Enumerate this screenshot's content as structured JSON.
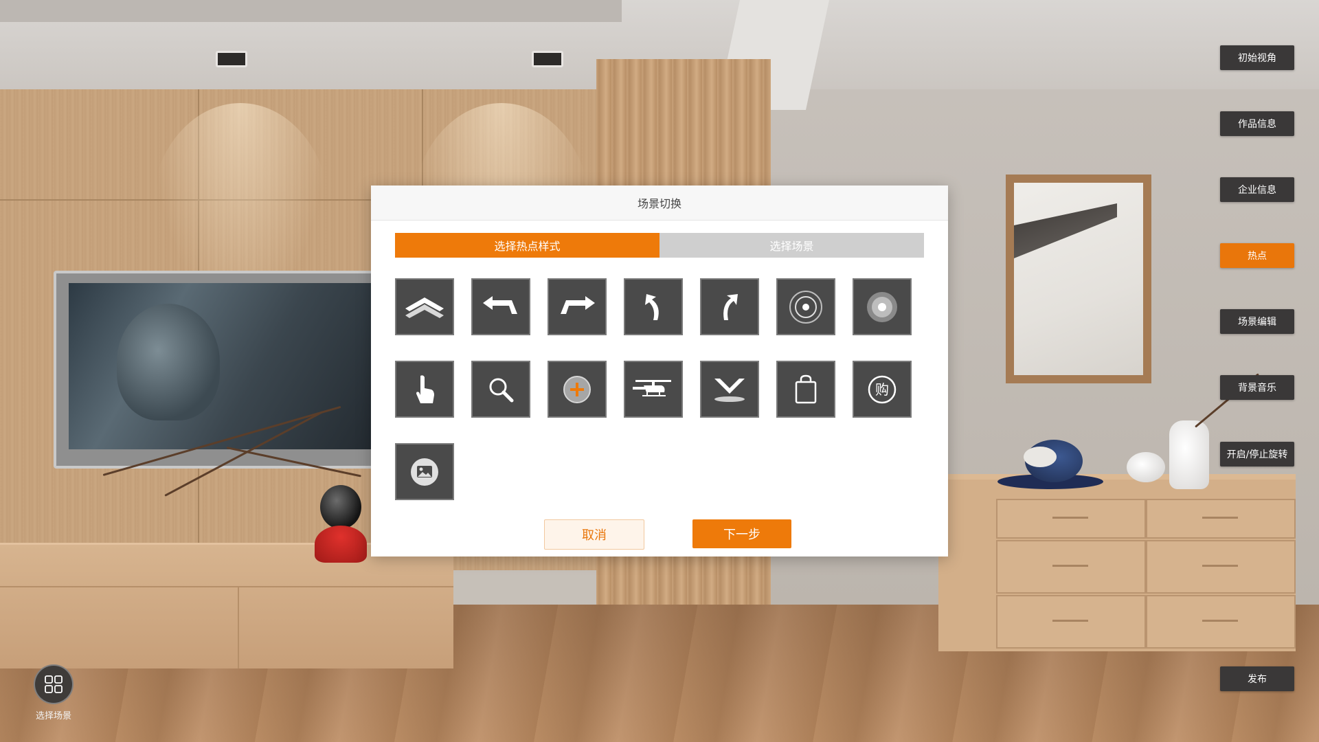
{
  "side_menu": {
    "items": [
      {
        "label": "初始视角",
        "active": false
      },
      {
        "label": "作品信息",
        "active": false
      },
      {
        "label": "企业信息",
        "active": false
      },
      {
        "label": "热点",
        "active": true
      },
      {
        "label": "场景编辑",
        "active": false
      },
      {
        "label": "背景音乐",
        "active": false
      },
      {
        "label": "开启/停止旋转",
        "active": false
      }
    ],
    "publish_label": "发布"
  },
  "scene_selector": {
    "label": "选择场景",
    "icon": "grid-icon"
  },
  "dialog": {
    "title": "场景切换",
    "tabs": [
      {
        "label": "选择热点样式",
        "active": true
      },
      {
        "label": "选择场景",
        "active": false
      }
    ],
    "hotspot_icons": [
      "double-chevron-up-icon",
      "turn-left-arrow-icon",
      "turn-right-arrow-icon",
      "curve-up-left-arrow-icon",
      "curve-up-right-arrow-icon",
      "target-ring-icon",
      "target-dot-icon",
      "pointing-hand-icon",
      "magnifier-icon",
      "plus-circle-icon",
      "helicopter-icon",
      "chevron-down-icon",
      "shopping-bag-icon",
      "purchase-badge-icon",
      "image-icon"
    ],
    "purchase_glyph": "购",
    "cancel_label": "取消",
    "next_label": "下一步"
  },
  "colors": {
    "accent": "#ee7a0a",
    "menu_bg": "#3a3838",
    "icon_tile_bg": "#4a4a4a",
    "tab_inactive": "#cfcfcf"
  }
}
